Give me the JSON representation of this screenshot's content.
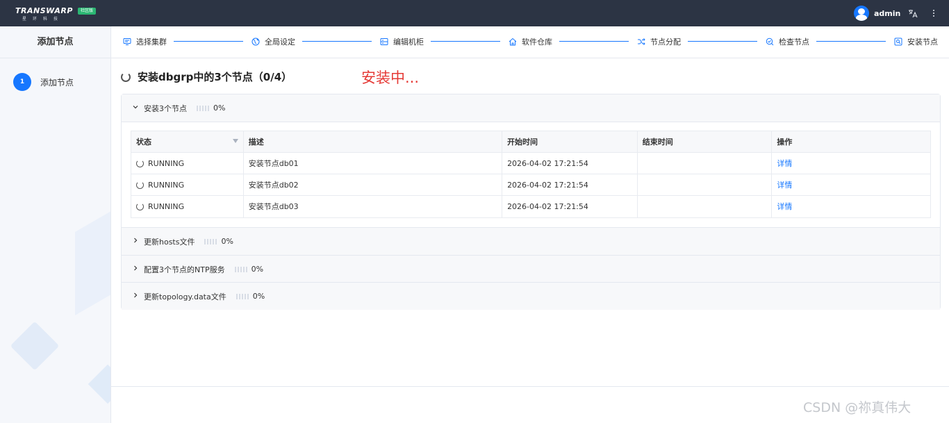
{
  "topbar": {
    "logo_text": "TRANSWARP",
    "logo_subtext": "星环科技",
    "edition_badge": "社区版",
    "username": "admin"
  },
  "sidebar": {
    "title": "添加节点",
    "step_number": "1",
    "step_label": "添加节点"
  },
  "steps": [
    {
      "label": "选择集群",
      "icon": "cluster-icon"
    },
    {
      "label": "全局设定",
      "icon": "globe-icon"
    },
    {
      "label": "编辑机柜",
      "icon": "rack-icon"
    },
    {
      "label": "软件仓库",
      "icon": "home-icon"
    },
    {
      "label": "节点分配",
      "icon": "shuffle-icon"
    },
    {
      "label": "检查节点",
      "icon": "check-search-icon"
    },
    {
      "label": "安装节点",
      "icon": "install-icon"
    }
  ],
  "main": {
    "heading": "安装dbgrp中的3个节点（0/4）",
    "annotation": "安装中..."
  },
  "sections": [
    {
      "title": "安装3个节点",
      "progress": "0%",
      "expanded": true
    },
    {
      "title": "更新hosts文件",
      "progress": "0%",
      "expanded": false
    },
    {
      "title": "配置3个节点的NTP服务",
      "progress": "0%",
      "expanded": false
    },
    {
      "title": "更新topology.data文件",
      "progress": "0%",
      "expanded": false
    }
  ],
  "table": {
    "headers": [
      "状态",
      "描述",
      "开始时间",
      "结束时间",
      "操作"
    ],
    "rows": [
      {
        "status": "RUNNING",
        "desc": "安装节点db01",
        "start": "2026-04-02 17:21:54",
        "end": "",
        "action": "详情"
      },
      {
        "status": "RUNNING",
        "desc": "安装节点db02",
        "start": "2026-04-02 17:21:54",
        "end": "",
        "action": "详情"
      },
      {
        "status": "RUNNING",
        "desc": "安装节点db03",
        "start": "2026-04-02 17:21:54",
        "end": "",
        "action": "详情"
      }
    ]
  },
  "watermark": "CSDN @祢真伟大",
  "colors": {
    "accent": "#1677ff",
    "header_bg": "#2c3444",
    "annotation": "#e53935"
  }
}
